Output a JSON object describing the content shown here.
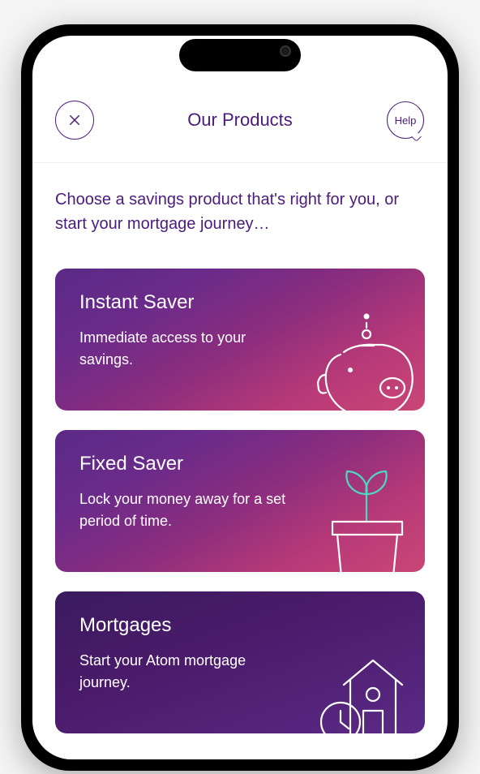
{
  "header": {
    "title": "Our Products",
    "help_label": "Help"
  },
  "intro": "Choose a savings product that's right for you, or start your mortgage journey…",
  "products": [
    {
      "title": "Instant Saver",
      "desc": "Immediate access to your savings."
    },
    {
      "title": "Fixed Saver",
      "desc": "Lock your money away for a set period of time."
    },
    {
      "title": "Mortgages",
      "desc": "Start your Atom mortgage journey."
    }
  ]
}
